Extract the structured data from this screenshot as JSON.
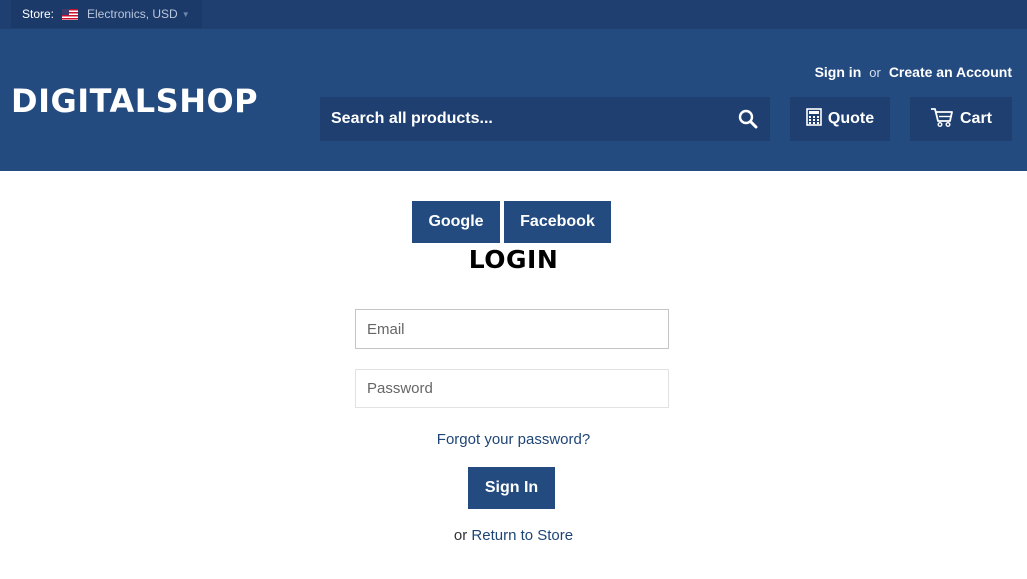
{
  "topbar": {
    "store_label": "Store:",
    "store_value": "Electronics, USD",
    "flag_icon": "us-flag-icon",
    "chevron_icon": "chevron-down-icon"
  },
  "header": {
    "logo": "DIGITALSHOP",
    "sign_in": "Sign in",
    "or": "or",
    "create_account": "Create an Account",
    "search": {
      "placeholder": "Search all products...",
      "icon": "search-icon"
    },
    "quote_label": "Quote",
    "quote_icon": "calculator-icon",
    "cart_label": "Cart",
    "cart_icon": "cart-icon"
  },
  "login": {
    "google_label": "Google",
    "facebook_label": "Facebook",
    "title": "LOGIN",
    "email_placeholder": "Email",
    "email_value": "",
    "password_placeholder": "Password",
    "password_value": "",
    "forgot_label": "Forgot your password?",
    "signin_label": "Sign In",
    "return_prefix": "or",
    "return_label": "Return to Store"
  },
  "colors": {
    "header_bg": "#234b80",
    "topbar_bg": "#1e3f70",
    "button_bg": "#234b80",
    "link": "#1f4576"
  }
}
